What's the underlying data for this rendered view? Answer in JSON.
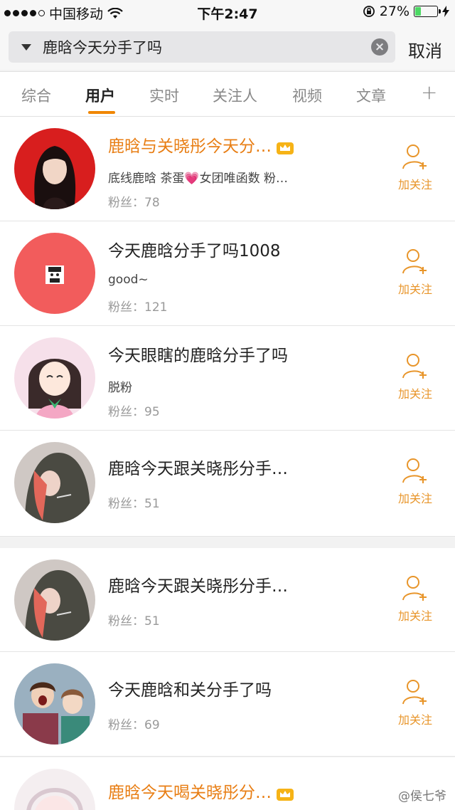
{
  "status": {
    "carrier": "中国移动",
    "time": "下午2:47",
    "battery": "27%",
    "battery_level": 0.27
  },
  "search": {
    "query": "鹿晗今天分手了吗",
    "cancel_label": "取消"
  },
  "tabs": [
    {
      "label": "综合"
    },
    {
      "label": "用户"
    },
    {
      "label": "实时"
    },
    {
      "label": "关注人"
    },
    {
      "label": "视频"
    },
    {
      "label": "文章"
    }
  ],
  "tab_plus": "+",
  "users": [
    {
      "name": "鹿晗与关晓彤今天分…",
      "bio": "底线鹿晗 茶蛋💗女团唯函数 粉…",
      "fans": "粉丝：78",
      "follow": "加关注"
    },
    {
      "name": "今天鹿晗分手了吗1008",
      "bio": "good~",
      "fans": "粉丝：121",
      "follow": "加关注"
    },
    {
      "name": "今天眼瞎的鹿晗分手了吗",
      "bio": "脱粉",
      "fans": "粉丝：95",
      "follow": "加关注"
    },
    {
      "name": "鹿晗今天跟关晓彤分手…",
      "fans": "粉丝：51",
      "follow": "加关注"
    },
    {
      "name": "鹿晗今天跟关晓彤分手…",
      "fans": "粉丝：51",
      "follow": "加关注"
    },
    {
      "name": "今天鹿晗和关分手了吗",
      "fans": "粉丝：69",
      "follow": "加关注"
    },
    {
      "name": "鹿晗今天喝关晓彤分…"
    }
  ],
  "watermark": "@侯七爷",
  "colors": {
    "accent": "#f08600",
    "follow": "#e8952a",
    "vip_name": "#e87e14"
  }
}
